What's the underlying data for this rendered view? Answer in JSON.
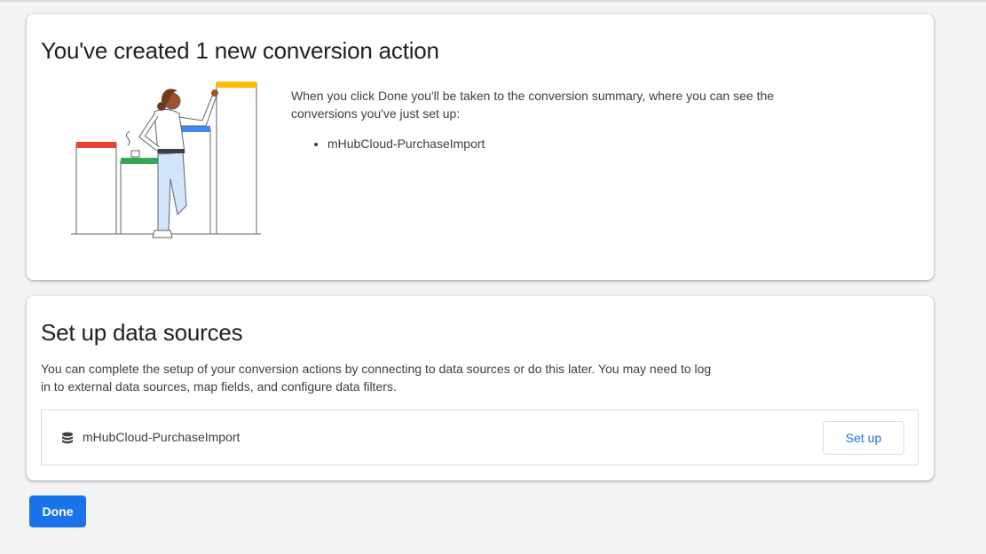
{
  "created_card": {
    "title": "You've created 1 new conversion action",
    "summary": "When you click Done you'll be taken to the conversion summary, where you can see the conversions you've just set up:",
    "conversions": [
      "mHubCloud-PurchaseImport"
    ]
  },
  "data_sources_card": {
    "title": "Set up data sources",
    "description": "You can complete the setup of your conversion actions by connecting to data sources or do this later. You may need to log in to external data sources, map fields, and configure data filters.",
    "sources": [
      {
        "icon": "database-icon",
        "name": "mHubCloud-PurchaseImport",
        "action_label": "Set up"
      }
    ]
  },
  "footer": {
    "done_label": "Done"
  },
  "colors": {
    "primary": "#1a73e8",
    "bar_red": "#ea4335",
    "bar_green": "#34a853",
    "bar_blue": "#4285f4",
    "bar_yellow": "#fbbc04"
  }
}
